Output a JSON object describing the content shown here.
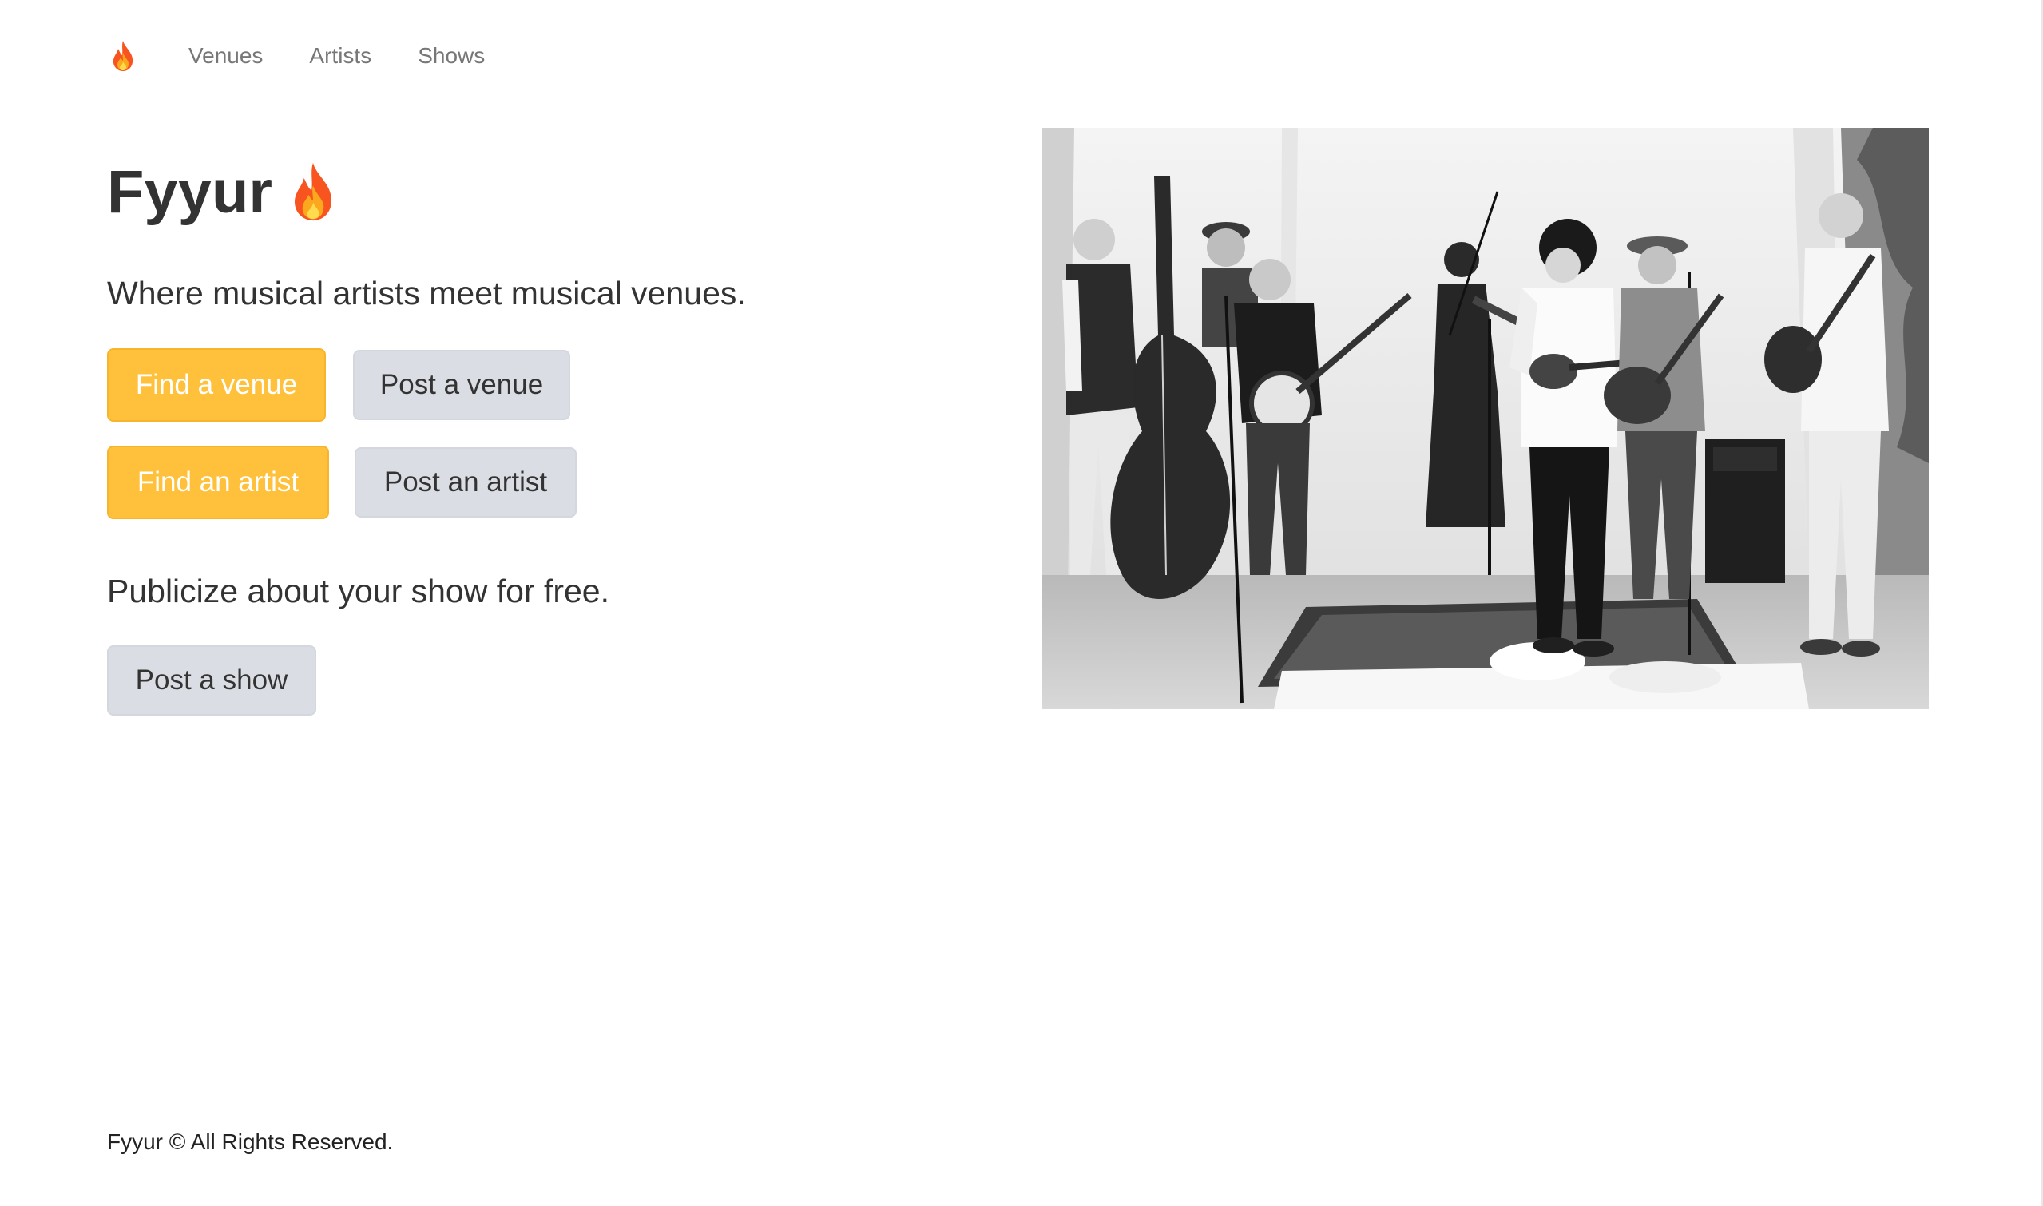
{
  "nav": {
    "logo_icon": "fire-icon",
    "links": [
      "Venues",
      "Artists",
      "Shows"
    ]
  },
  "hero": {
    "title": "Fyyur",
    "title_icon": "fire-icon",
    "lead": "Where musical artists meet musical venues.",
    "buttons": {
      "find_venue": "Find a venue",
      "post_venue": "Post a venue",
      "find_artist": "Find an artist",
      "post_artist": "Post an artist"
    },
    "publicize": "Publicize about your show for free.",
    "post_show": "Post a show"
  },
  "footer": {
    "text": "Fyyur © All Rights Reserved."
  },
  "colors": {
    "warning": "#ffc13b",
    "default_button": "#dadde3",
    "text": "#333333",
    "nav_link": "#777777"
  }
}
